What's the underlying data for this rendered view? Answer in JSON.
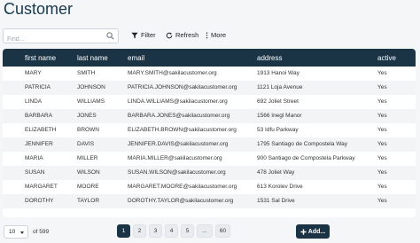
{
  "page": {
    "title": "Customer"
  },
  "toolbar": {
    "search_placeholder": "Find...",
    "filter_label": "Filter",
    "refresh_label": "Refresh",
    "more_label": "More"
  },
  "table": {
    "headers": [
      "first name",
      "last name",
      "email",
      "address",
      "active"
    ],
    "rows": [
      [
        "MARY",
        "SMITH",
        "MARY.SMITH@sakilacustomer.org",
        "1913 Hanoi Way",
        "Yes"
      ],
      [
        "PATRICIA",
        "JOHNSON",
        "PATRICIA.JOHNSON@sakilacustomer.org",
        "1121 Loja Avenue",
        "Yes"
      ],
      [
        "LINDA",
        "WILLIAMS",
        "LINDA.WILLIAMS@sakilacustomer.org",
        "692 Joliet Street",
        "Yes"
      ],
      [
        "BARBARA",
        "JONES",
        "BARBARA.JONES@sakilacustomer.org",
        "1566 Inegl Manor",
        "Yes"
      ],
      [
        "ELIZABETH",
        "BROWN",
        "ELIZABETH.BROWN@sakilacustomer.org",
        "53 Idfu Parkway",
        "Yes"
      ],
      [
        "JENNIFER",
        "DAVIS",
        "JENNIFER.DAVIS@sakilacustomer.org",
        "1795 Santiago de Compostela Way",
        "Yes"
      ],
      [
        "MARIA",
        "MILLER",
        "MARIA.MILLER@sakilacustomer.org",
        "900 Santiago de Compostela Parkway",
        "Yes"
      ],
      [
        "SUSAN",
        "WILSON",
        "SUSAN.WILSON@sakilacustomer.org",
        "478 Joliet Way",
        "Yes"
      ],
      [
        "MARGARET",
        "MOORE",
        "MARGARET.MOORE@sakilacustomer.org",
        "613 Korolev Drive",
        "Yes"
      ],
      [
        "DOROTHY",
        "TAYLOR",
        "DOROTHY.TAYLOR@sakilacustomer.org",
        "1531 Sal Drive",
        "Yes"
      ]
    ]
  },
  "footer": {
    "page_size": "10",
    "of_count": "of 599",
    "pages": [
      "1",
      "2",
      "3",
      "4",
      "5",
      "...",
      "60"
    ],
    "active_page": "1",
    "add_label": "Add..."
  },
  "colors": {
    "header_bg": "#1b3445",
    "accent": "#1b3445",
    "page_bg": "#f4f6f8"
  },
  "icons": {
    "search": "search-icon",
    "filter": "filter-icon",
    "refresh": "refresh-icon",
    "more": "more-vertical-icon",
    "add": "plus-icon"
  }
}
